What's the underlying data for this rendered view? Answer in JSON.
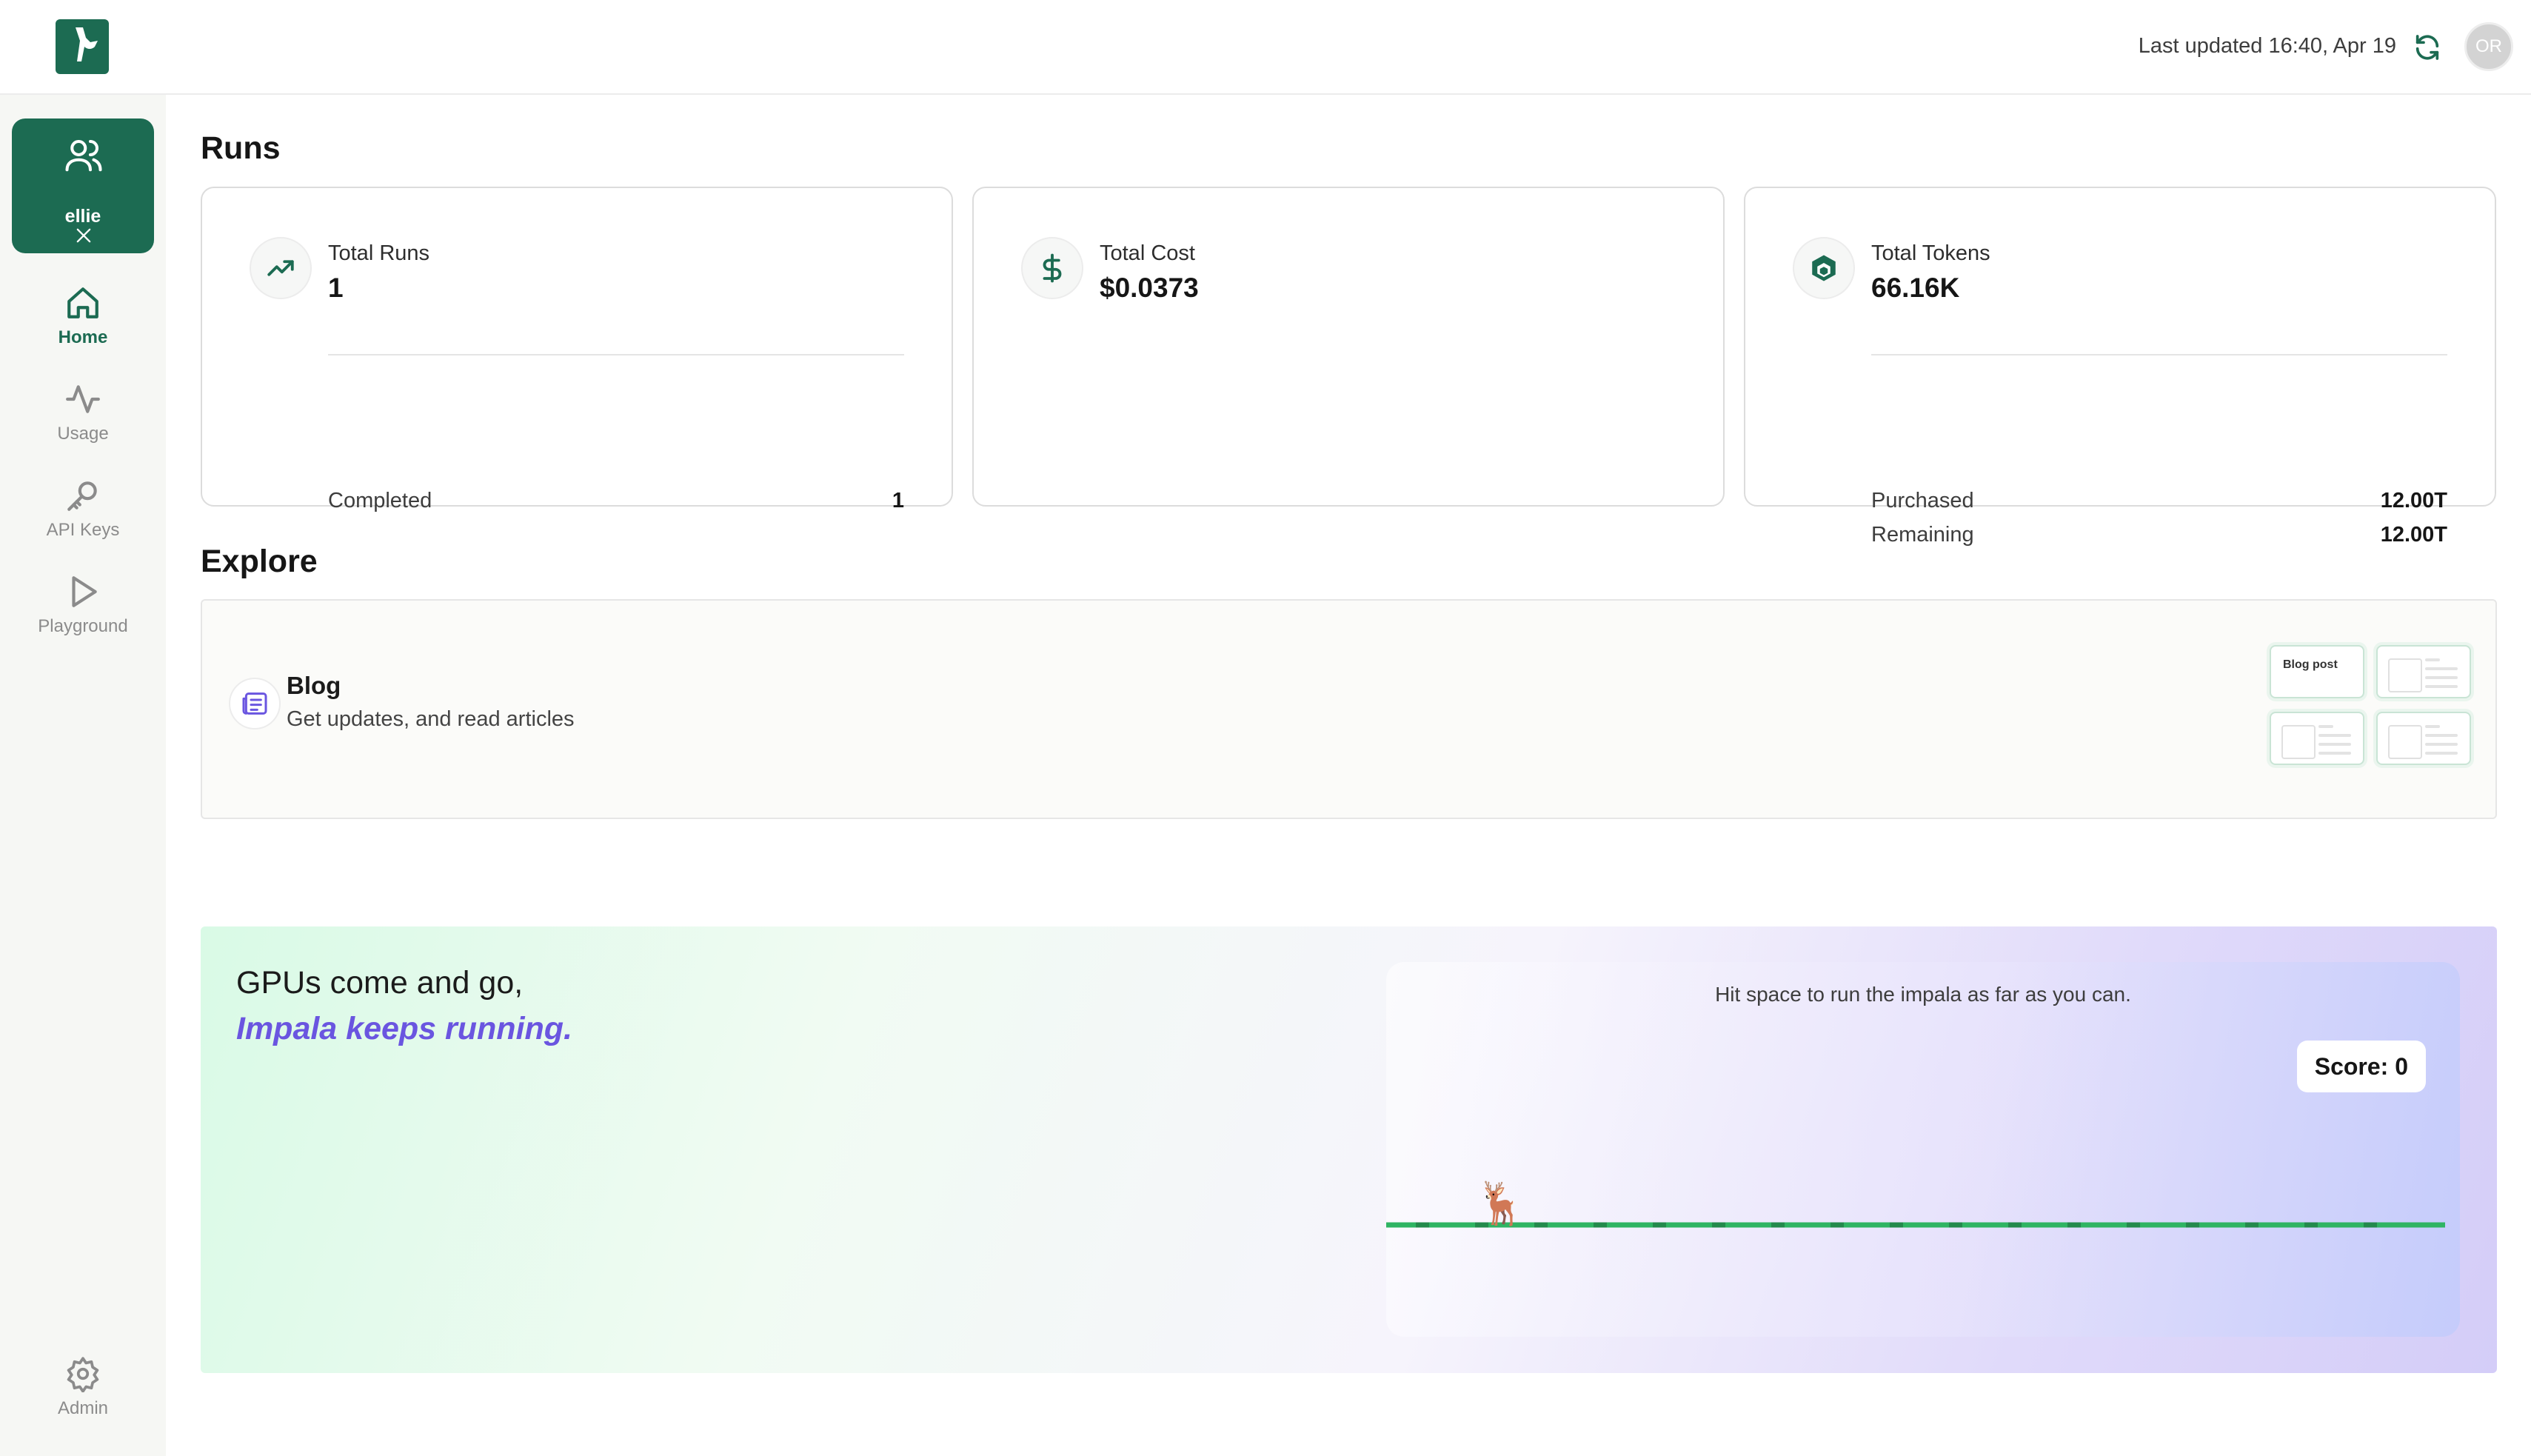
{
  "header": {
    "last_updated": "Last updated 16:40, Apr 19",
    "avatar_initials": "OR"
  },
  "sidebar": {
    "team_name": "ellie",
    "items": [
      {
        "label": "Home",
        "icon": "home-icon",
        "active": true
      },
      {
        "label": "Usage",
        "icon": "activity-icon",
        "active": false
      },
      {
        "label": "API Keys",
        "icon": "key-icon",
        "active": false
      },
      {
        "label": "Playground",
        "icon": "play-icon",
        "active": false
      },
      {
        "label": "Admin",
        "icon": "gear-icon",
        "active": false
      }
    ]
  },
  "runs": {
    "heading": "Runs",
    "cards": [
      {
        "label": "Total Runs",
        "value": "1",
        "icon": "trending-up-icon",
        "rows": [
          {
            "label": "Completed",
            "value": "1"
          }
        ]
      },
      {
        "label": "Total Cost",
        "value": "$0.0373",
        "icon": "dollar-icon",
        "rows": []
      },
      {
        "label": "Total Tokens",
        "value": "66.16K",
        "icon": "cube-icon",
        "rows": [
          {
            "label": "Purchased",
            "value": "12.00T"
          },
          {
            "label": "Remaining",
            "value": "12.00T"
          }
        ]
      }
    ]
  },
  "explore": {
    "heading": "Explore",
    "blog": {
      "title": "Blog",
      "subtitle": "Get updates, and read articles",
      "thumb_label": "Blog post"
    }
  },
  "banner": {
    "line1": "GPUs come and go,",
    "line2": "Impala keeps running.",
    "hint": "Hit space to run the impala as far as you can.",
    "score": "Score: 0",
    "runner": "🦌"
  },
  "colors": {
    "brand": "#1c6b52",
    "accent": "#6a55e0",
    "track": "#2fb463"
  }
}
